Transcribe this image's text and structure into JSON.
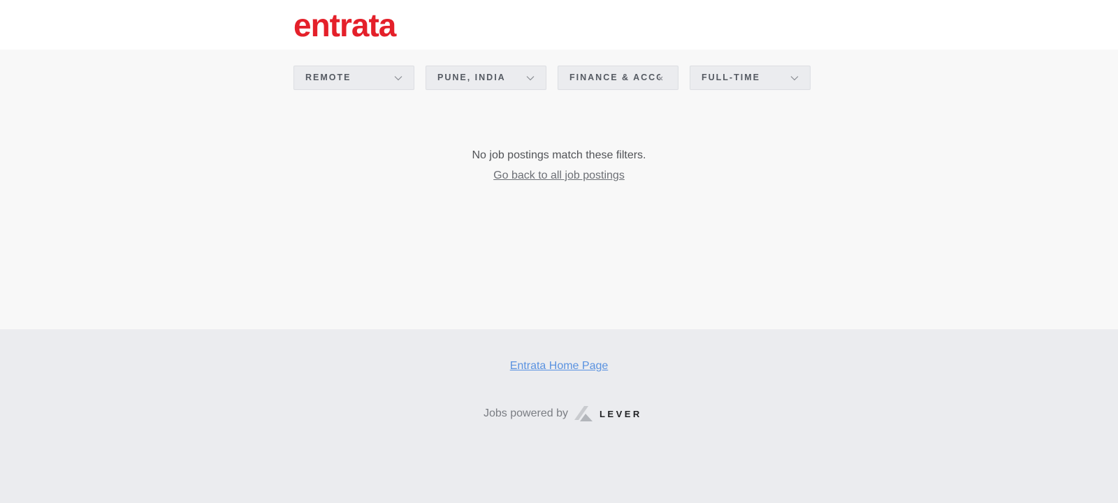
{
  "header": {
    "logo_text": "entrata",
    "brand_color": "#e4202a"
  },
  "filters": [
    {
      "label": "REMOTE",
      "icon": "chevron-down-icon"
    },
    {
      "label": "PUNE, INDIA",
      "icon": "chevron-down-icon"
    },
    {
      "label": "FINANCE & ACCOUNTING",
      "icon": "close-icon"
    },
    {
      "label": "FULL-TIME",
      "icon": "chevron-down-icon"
    }
  ],
  "main": {
    "empty_message": "No job postings match these filters.",
    "back_link": "Go back to all job postings"
  },
  "footer": {
    "home_link": "Entrata Home Page",
    "powered_by": "Jobs powered by",
    "lever_text": "LEVER",
    "link_color": "#5a92e0"
  }
}
